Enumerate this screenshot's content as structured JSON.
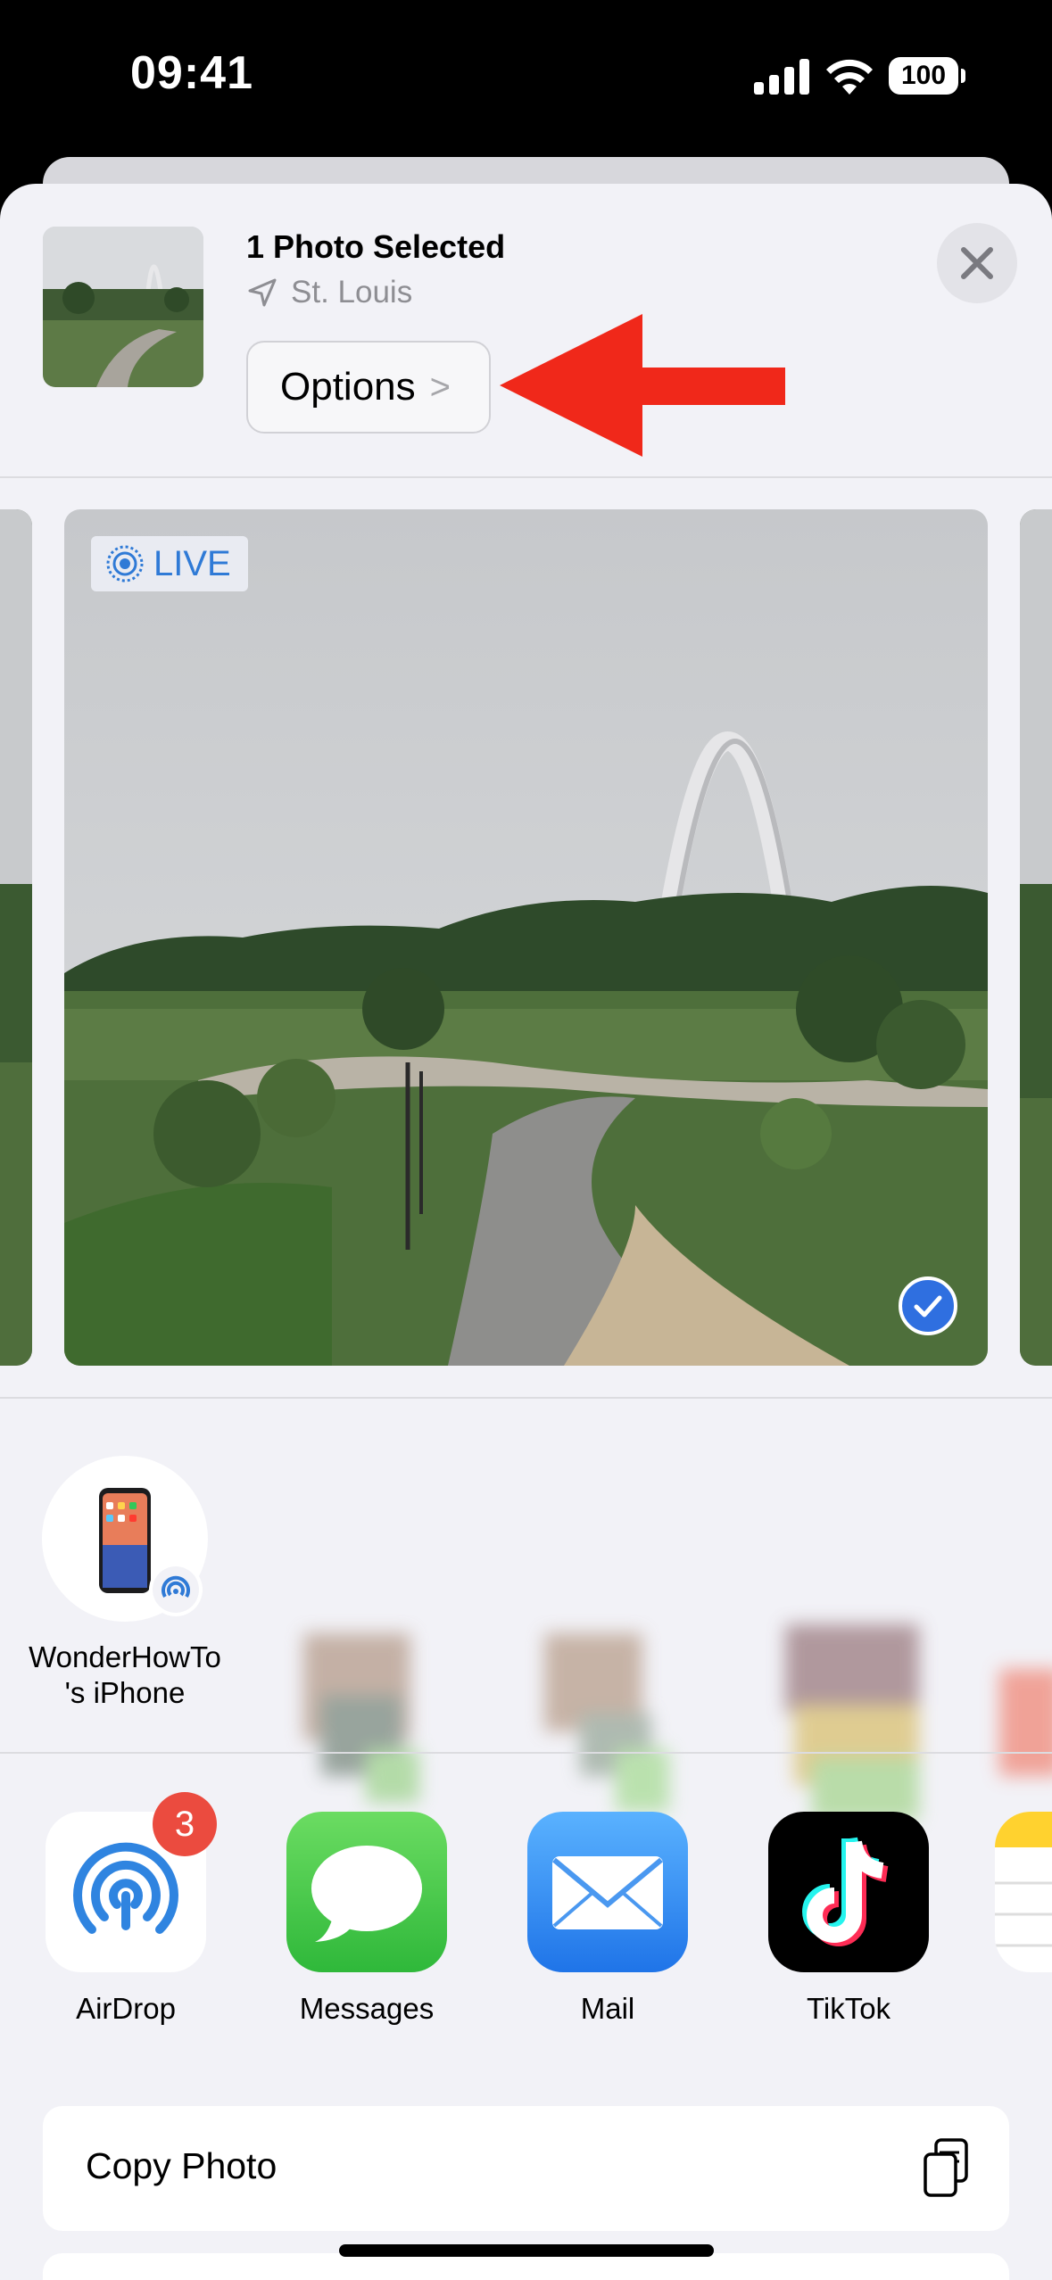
{
  "status_bar": {
    "time": "09:41",
    "battery": "100"
  },
  "header": {
    "title": "1 Photo Selected",
    "location": "St. Louis",
    "options_label": "Options",
    "options_chevron": ">"
  },
  "photo": {
    "live_label": "LIVE",
    "selected": true
  },
  "people": [
    {
      "name_line1": "WonderHowTo",
      "name_line2": "'s iPhone"
    }
  ],
  "apps": [
    {
      "label": "AirDrop",
      "badge": "3"
    },
    {
      "label": "Messages"
    },
    {
      "label": "Mail"
    },
    {
      "label": "TikTok"
    }
  ],
  "actions": [
    {
      "label": "Copy Photo",
      "icon": "copy-icon"
    }
  ],
  "colors": {
    "sheet": "#f2f2f7",
    "accent": "#2f6fe0",
    "badge": "#eb4b3f",
    "annotation_arrow": "#f0281a"
  }
}
